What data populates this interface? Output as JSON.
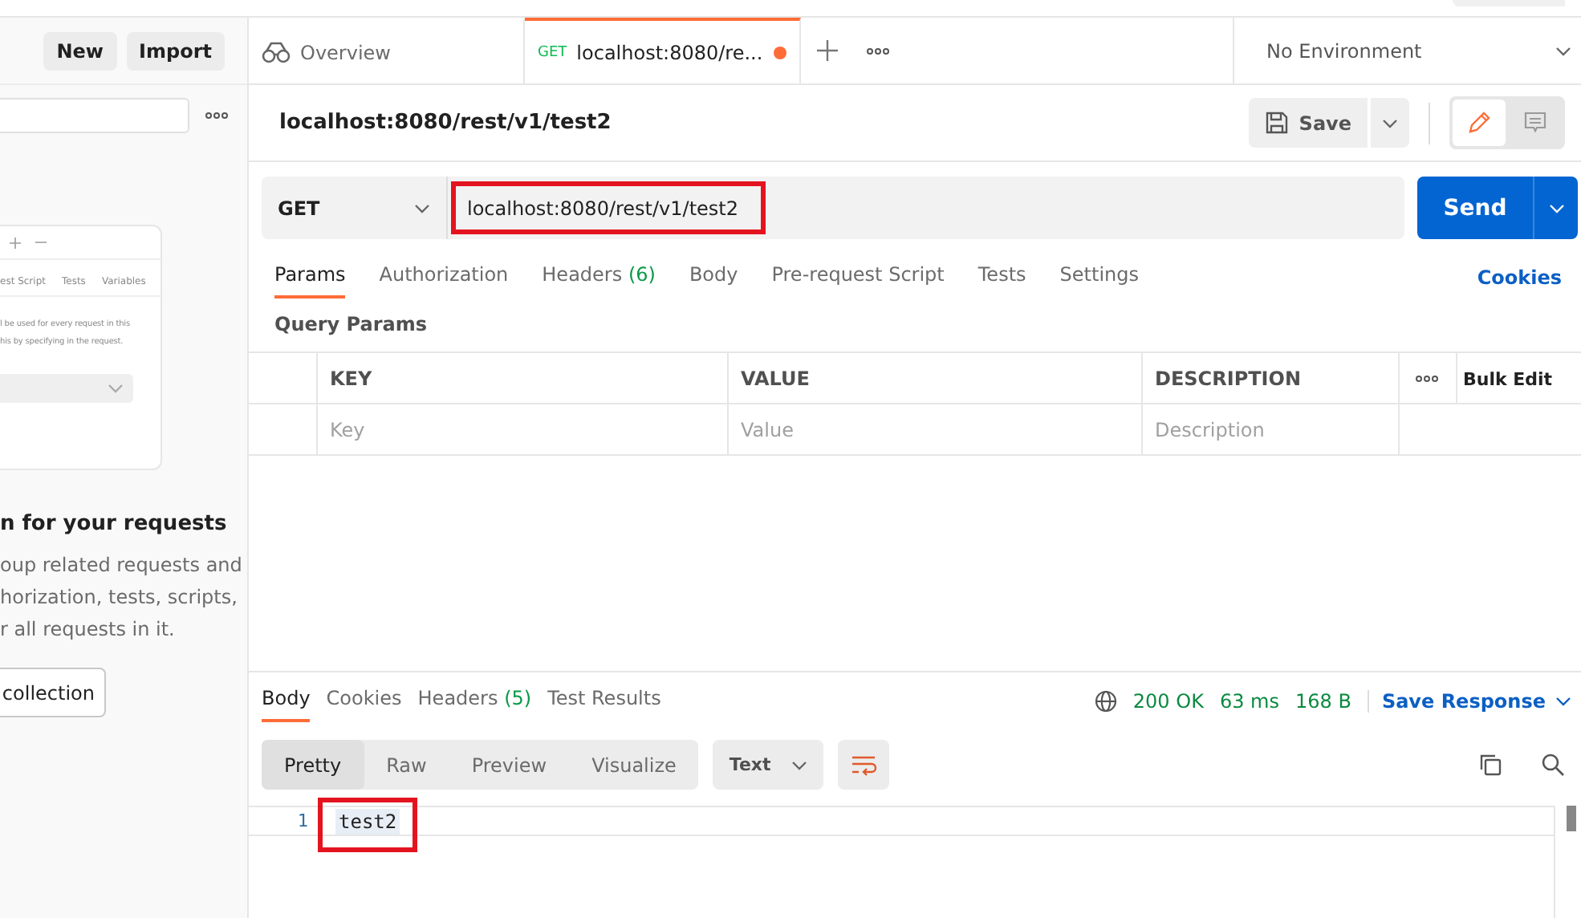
{
  "sidebar": {
    "buttons": [
      {
        "label": "New"
      },
      {
        "label": "Import"
      }
    ],
    "illustration": {
      "tabs": [
        "est Script",
        "Tests",
        "Variables"
      ],
      "text": [
        "l be used for every request in this",
        "his by specifying in the request."
      ]
    },
    "heading": "n for your requests",
    "description": [
      "oup related requests and",
      "horization, tests, scripts,",
      "r all requests in it."
    ],
    "create_button": "collection"
  },
  "tabs": [
    {
      "kind": "overview",
      "label": "Overview",
      "selected": false,
      "unsaved": false
    },
    {
      "kind": "request",
      "method": "GET",
      "label": "localhost:8080/re...",
      "selected": true,
      "unsaved": true
    }
  ],
  "environment": "No Environment",
  "request": {
    "name": "localhost:8080/rest/v1/test2",
    "save_label": "Save",
    "modes": [
      {
        "kind": "edit",
        "selected": true
      },
      {
        "kind": "comments",
        "selected": false
      }
    ],
    "method": "GET",
    "url": "localhost:8080/rest/v1/test2",
    "url_highlighted": true,
    "send_label": "Send",
    "tabs": [
      {
        "label": "Params",
        "selected": true
      },
      {
        "label": "Authorization",
        "selected": false
      },
      {
        "label": "Headers",
        "count": "(6)",
        "selected": false
      },
      {
        "label": "Body",
        "selected": false
      },
      {
        "label": "Pre-request Script",
        "selected": false
      },
      {
        "label": "Tests",
        "selected": false
      },
      {
        "label": "Settings",
        "selected": false
      }
    ],
    "cookies_link": "Cookies",
    "section_title": "Query Params",
    "params_table": {
      "columns": [
        "KEY",
        "VALUE",
        "DESCRIPTION"
      ],
      "bulk_edit": "Bulk Edit",
      "placeholders": [
        "Key",
        "Value",
        "Description"
      ]
    }
  },
  "response": {
    "tabs": [
      {
        "label": "Body",
        "selected": true
      },
      {
        "label": "Cookies",
        "selected": false
      },
      {
        "label": "Headers",
        "count": "(5)",
        "selected": false
      },
      {
        "label": "Test Results",
        "selected": false
      }
    ],
    "status": "200 OK",
    "time": "63 ms",
    "size": "168 B",
    "save_response": "Save Response",
    "views": [
      {
        "label": "Pretty",
        "selected": true
      },
      {
        "label": "Raw",
        "selected": false
      },
      {
        "label": "Preview",
        "selected": false
      },
      {
        "label": "Visualize",
        "selected": false
      }
    ],
    "format": "Text",
    "lines": [
      {
        "number": "1",
        "text": "test2",
        "highlighted": true
      }
    ]
  }
}
